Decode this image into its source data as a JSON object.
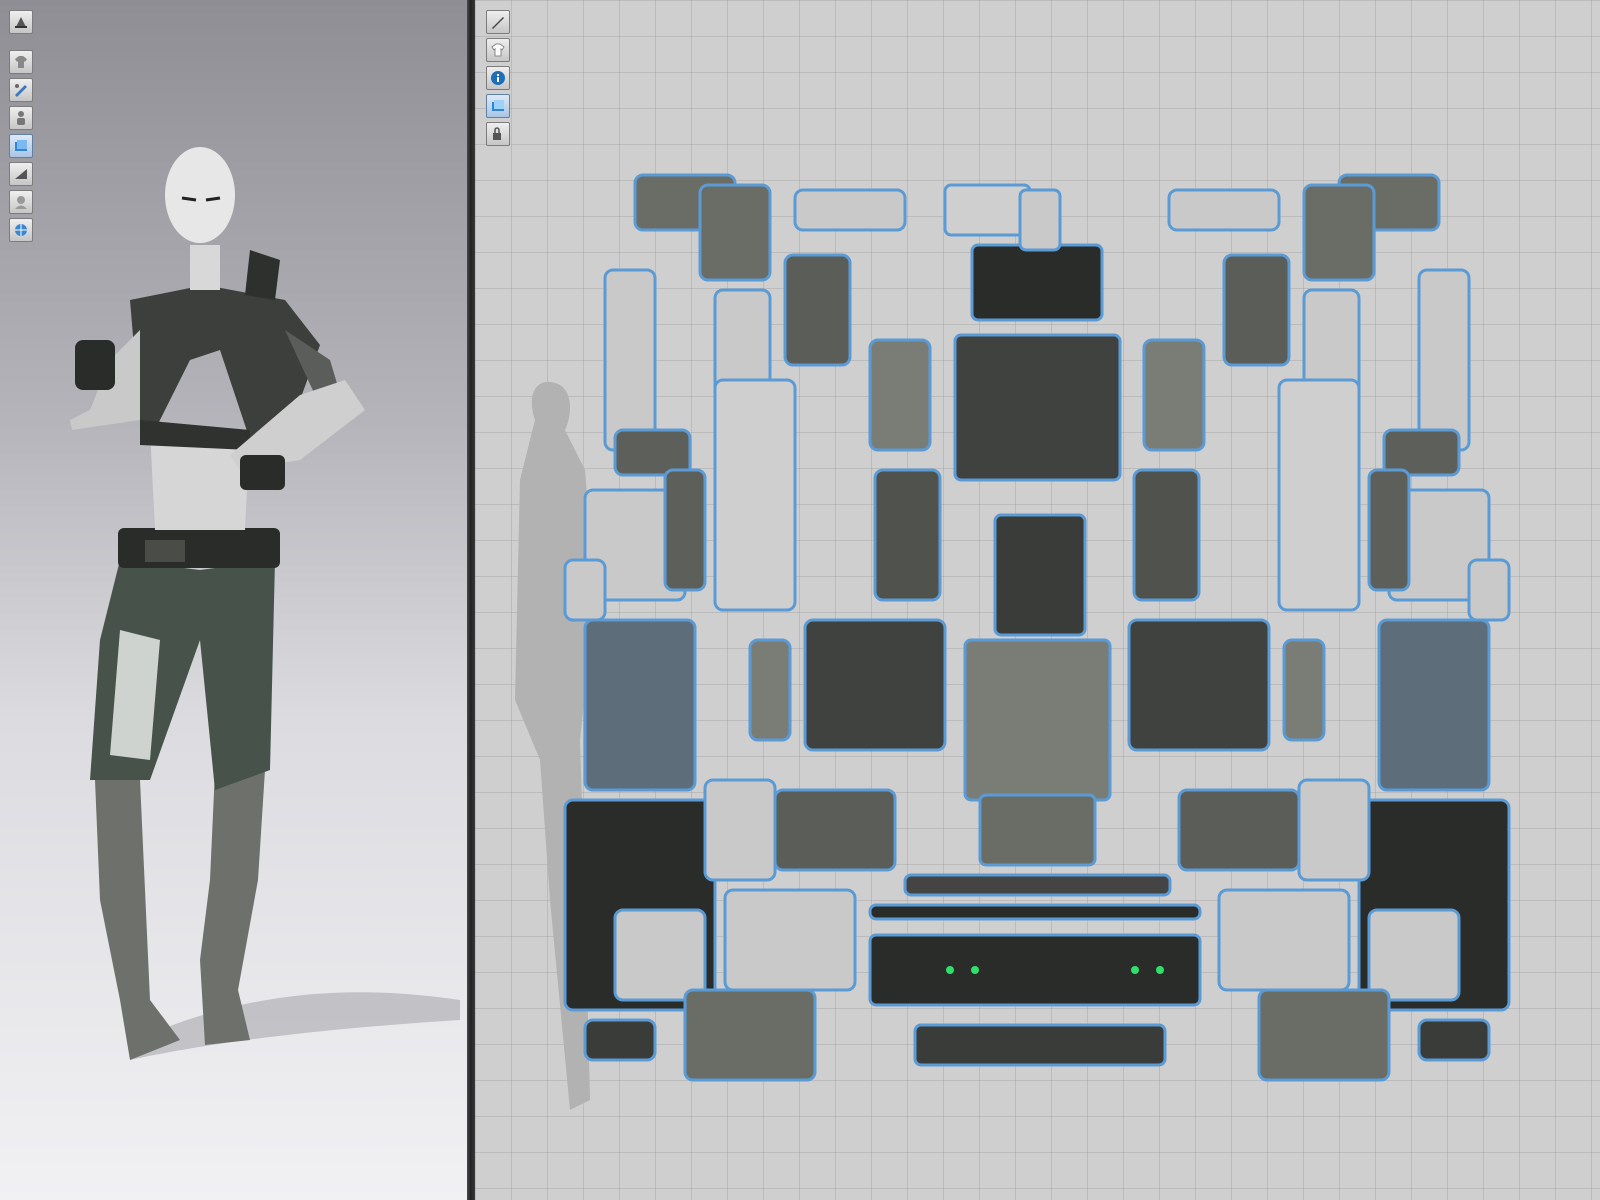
{
  "app": {
    "accent_color": "#5b9bd5",
    "background_3d_top": "#8e8e94",
    "background_2d": "#cfcfcf"
  },
  "toolbar_3d": {
    "buttons": [
      {
        "icon": "avatar-toggle-icon",
        "active": false
      },
      {
        "icon": "garment-display-icon",
        "active": false
      },
      {
        "icon": "pen-display-icon",
        "active": false
      },
      {
        "icon": "avatar-display-icon",
        "active": false
      },
      {
        "icon": "fabric-layer-icon",
        "active": true
      },
      {
        "icon": "thickness-icon",
        "active": false
      },
      {
        "icon": "avatar-head-icon",
        "active": false
      },
      {
        "icon": "texture-globe-icon",
        "active": false
      }
    ]
  },
  "toolbar_2d": {
    "buttons": [
      {
        "icon": "edit-pattern-icon",
        "active": false
      },
      {
        "icon": "show-garment-icon",
        "active": false
      },
      {
        "icon": "info-icon",
        "active": false
      },
      {
        "icon": "layer-icon",
        "active": true
      },
      {
        "icon": "lock-pattern-icon",
        "active": false
      }
    ]
  }
}
